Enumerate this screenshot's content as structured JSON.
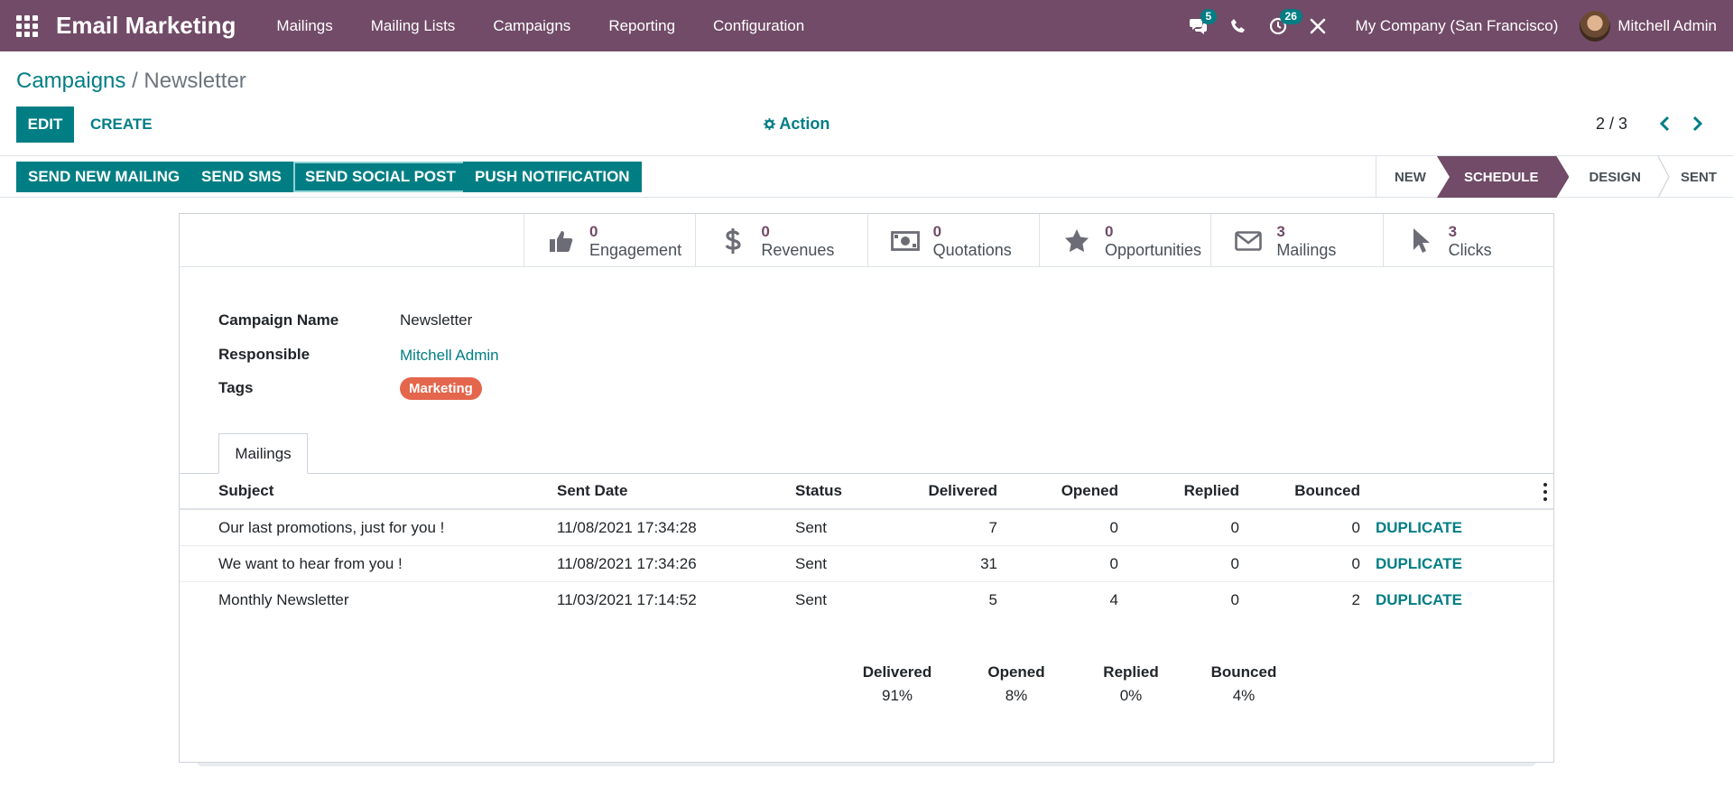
{
  "app": {
    "title": "Email Marketing"
  },
  "nav": {
    "menus": [
      "Mailings",
      "Mailing Lists",
      "Campaigns",
      "Reporting",
      "Configuration"
    ],
    "messages_count": "5",
    "activities_count": "26",
    "company": "My Company (San Francisco)",
    "user": "Mitchell Admin"
  },
  "breadcrumb": {
    "parent": "Campaigns",
    "separator": "/",
    "current": "Newsletter"
  },
  "toolbar": {
    "edit": "EDIT",
    "create": "CREATE",
    "action": "Action",
    "pager": "2 / 3"
  },
  "header_buttons": [
    "SEND NEW MAILING",
    "SEND SMS",
    "SEND SOCIAL POST",
    "PUSH NOTIFICATION"
  ],
  "stages": {
    "items": [
      "NEW",
      "SCHEDULE",
      "DESIGN",
      "SENT"
    ],
    "active": "SCHEDULE"
  },
  "stat_buttons": [
    {
      "value": "0",
      "label": "Engagement",
      "icon": "thumbs-up-icon"
    },
    {
      "value": "0",
      "label": "Revenues",
      "icon": "dollar-icon"
    },
    {
      "value": "0",
      "label": "Quotations",
      "icon": "money-icon"
    },
    {
      "value": "0",
      "label": "Opportunities",
      "icon": "star-icon"
    },
    {
      "value": "3",
      "label": "Mailings",
      "icon": "envelope-icon"
    },
    {
      "value": "3",
      "label": "Clicks",
      "icon": "pointer-icon"
    }
  ],
  "form": {
    "campaign_name_label": "Campaign Name",
    "campaign_name": "Newsletter",
    "responsible_label": "Responsible",
    "responsible": "Mitchell Admin",
    "tags_label": "Tags",
    "tag": "Marketing",
    "tag_color": "#e4664d"
  },
  "tab": {
    "label": "Mailings"
  },
  "table": {
    "columns": [
      "Subject",
      "Sent Date",
      "Status",
      "Delivered",
      "Opened",
      "Replied",
      "Bounced"
    ],
    "rows": [
      {
        "subject": "Our last promotions, just for you !",
        "sent_date": "11/08/2021 17:34:28",
        "status": "Sent",
        "delivered": "7",
        "opened": "0",
        "replied": "0",
        "bounced": "0",
        "action": "DUPLICATE"
      },
      {
        "subject": "We want to hear from you !",
        "sent_date": "11/08/2021 17:34:26",
        "status": "Sent",
        "delivered": "31",
        "opened": "0",
        "replied": "0",
        "bounced": "0",
        "action": "DUPLICATE"
      },
      {
        "subject": "Monthly Newsletter",
        "sent_date": "11/03/2021 17:14:52",
        "status": "Sent",
        "delivered": "5",
        "opened": "4",
        "replied": "0",
        "bounced": "2",
        "action": "DUPLICATE"
      }
    ]
  },
  "summary": [
    {
      "label": "Delivered",
      "value": "91%"
    },
    {
      "label": "Opened",
      "value": "8%"
    },
    {
      "label": "Replied",
      "value": "0%"
    },
    {
      "label": "Bounced",
      "value": "4%"
    }
  ],
  "colors": {
    "brand": "#714b67",
    "accent": "#017e84"
  }
}
